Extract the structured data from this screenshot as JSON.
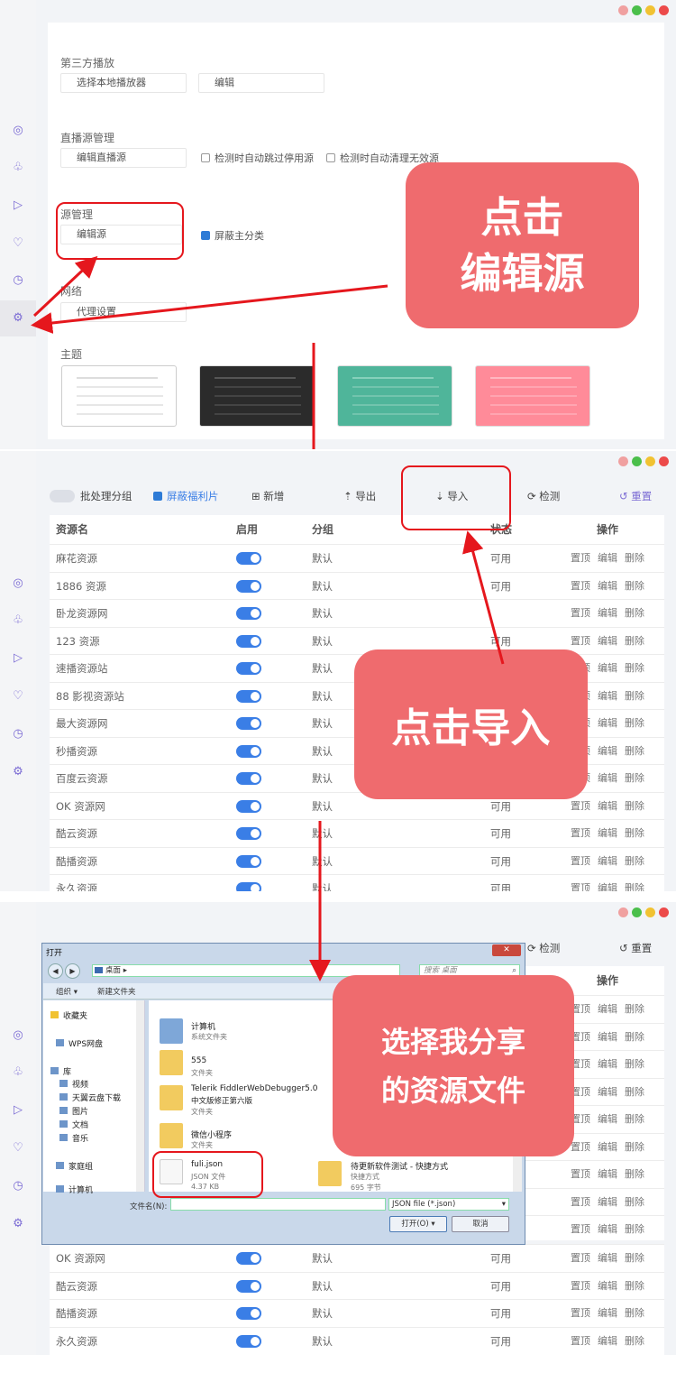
{
  "colors": {
    "accent": "#3a7ee6",
    "callout": "#ef6b6e",
    "highlight": "#e5171d",
    "sidebar_icon": "#7b6bd4"
  },
  "sidebar": {
    "icons": [
      "aperture-icon",
      "thumbs-up-icon",
      "play-icon",
      "heart-icon",
      "clock-icon",
      "gear-icon"
    ]
  },
  "step1": {
    "third_party": {
      "title": "第三方播放",
      "select_btn": "选择本地播放器",
      "edit_btn": "编辑"
    },
    "live": {
      "title": "直播源管理",
      "edit_btn": "编辑直播源",
      "chk1": "检测时自动跳过停用源",
      "chk2": "检测时自动清理无效源"
    },
    "source": {
      "title": "源管理",
      "edit_btn": "编辑源",
      "chk": "屏蔽主分类"
    },
    "network": {
      "title": "网络",
      "proxy_btn": "代理设置"
    },
    "theme": {
      "title": "主题"
    },
    "callout": [
      "点击",
      "编辑源"
    ]
  },
  "toolbar": {
    "batch": "批处理分组",
    "hide": "屏蔽福利片",
    "add": "新增",
    "export": "导出",
    "import": "导入",
    "check": "检测",
    "reset": "重置"
  },
  "table": {
    "headers": {
      "name": "资源名",
      "enabled": "启用",
      "group": "分组",
      "status": "状态",
      "ops": "操作"
    },
    "ops": [
      "置顶",
      "编辑",
      "删除"
    ],
    "rows": [
      {
        "name": "麻花资源",
        "group": "默认",
        "status": "可用"
      },
      {
        "name": "1886 资源",
        "group": "默认",
        "status": "可用"
      },
      {
        "name": "卧龙资源网",
        "group": "默认",
        "status": ""
      },
      {
        "name": "123 资源",
        "group": "默认",
        "status": "可用"
      },
      {
        "name": "速播资源站",
        "group": "默认",
        "status": ""
      },
      {
        "name": "88 影视资源站",
        "group": "默认",
        "status": ""
      },
      {
        "name": "最大资源网",
        "group": "默认",
        "status": ""
      },
      {
        "name": "秒播资源",
        "group": "默认",
        "status": ""
      },
      {
        "name": "百度云资源",
        "group": "默认",
        "status": ""
      },
      {
        "name": "OK 资源网",
        "group": "默认",
        "status": "可用"
      },
      {
        "name": "酷云资源",
        "group": "默认",
        "status": "可用"
      },
      {
        "name": "酷播资源",
        "group": "默认",
        "status": "可用"
      },
      {
        "name": "永久资源",
        "group": "默认",
        "status": "可用"
      }
    ]
  },
  "step2": {
    "callout": "点击导入"
  },
  "step3": {
    "callout": [
      "选择我分享",
      "的资源文件"
    ],
    "rows": [
      {
        "name": "OK 资源网",
        "group": "默认",
        "status": "可用"
      },
      {
        "name": "酷云资源",
        "group": "默认",
        "status": "可用"
      },
      {
        "name": "酷播资源",
        "group": "默认",
        "status": "可用"
      },
      {
        "name": "永久资源",
        "group": "默认",
        "status": "可用"
      }
    ]
  },
  "dialog": {
    "title": "打开",
    "path": "桌面",
    "search": "搜索 桌面",
    "organize": "组织 ▾",
    "new_folder": "新建文件夹",
    "nav": [
      "收藏夹",
      "WPS网盘",
      "库",
      "视频",
      "天翼云盘下载",
      "图片",
      "文档",
      "音乐",
      "家庭组",
      "计算机"
    ],
    "files": [
      {
        "name": "计算机",
        "type": "系统文件夹"
      },
      {
        "name": "555",
        "type": "文件夹"
      },
      {
        "name": "Telerik FiddlerWebDebugger5.0",
        "line2": "中文版修正第六版",
        "type": "文件夹"
      },
      {
        "name": "微信小程序",
        "type": "文件夹"
      },
      {
        "name": "fuli.json",
        "type": "JSON 文件",
        "size": "4.37 KB"
      },
      {
        "name": "待更新软件测试 - 快捷方式",
        "type": "快捷方式",
        "size": "695 字节"
      }
    ],
    "filename_label": "文件名(N):",
    "filter": "JSON file (*.json)",
    "open": "打开(O)",
    "cancel": "取消"
  }
}
